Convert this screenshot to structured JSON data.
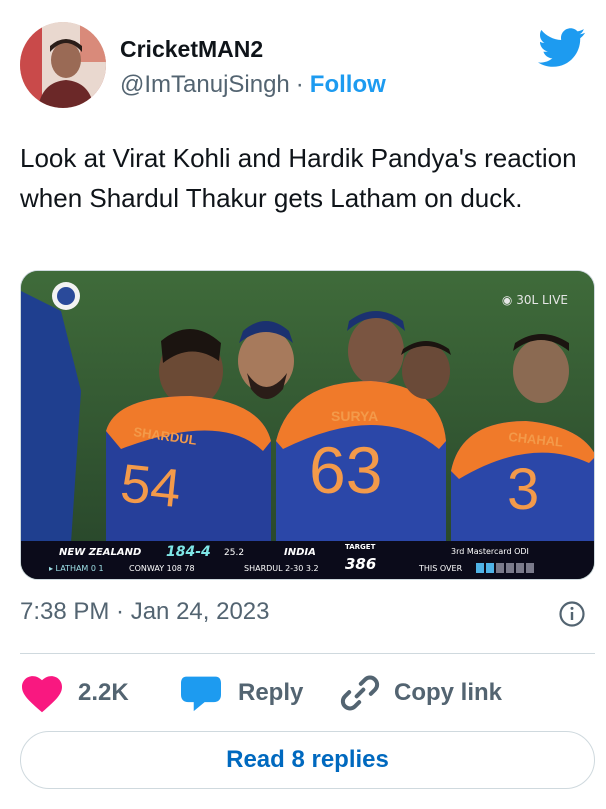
{
  "author": {
    "name": "CricketMAN2",
    "handle": "@ImTanujSingh",
    "separator": "·",
    "follow_label": "Follow",
    "avatar_icon": "user-avatar"
  },
  "brand": {
    "logo_icon": "twitter-bird-icon",
    "color": "#1d9bf0"
  },
  "tweet": {
    "text": "Look at Virat Kohli and Hardik Pandya's reaction when Shardul Thakur gets Latham on duck."
  },
  "media": {
    "live_tag": "◉ 30L LIVE",
    "jersey_names": [
      "SHARDUL",
      "SURYA",
      "CHAHAL"
    ],
    "jersey_numbers": [
      "54",
      "63",
      "3"
    ],
    "scoreboard": {
      "team1": "NEW ZEALAND",
      "score": "184-4",
      "overs": "25.2",
      "team2": "INDIA",
      "target_label": "TARGET",
      "target": "386",
      "series": "3rd Mastercard ODI",
      "batter1": "▸ LATHAM 0 1",
      "batter2": "CONWAY 108 78",
      "bowler": "SHARDUL 2-30 3.2",
      "this_over_label": "THIS OVER"
    }
  },
  "timestamp": "7:38 PM · Jan 24, 2023",
  "actions": {
    "like_count": "2.2K",
    "reply_label": "Reply",
    "copy_label": "Copy link"
  },
  "read_replies_label": "Read 8 replies",
  "colors": {
    "like": "#f91880",
    "reply": "#1d9bf0",
    "text_muted": "#536471",
    "link": "#0069bf"
  }
}
